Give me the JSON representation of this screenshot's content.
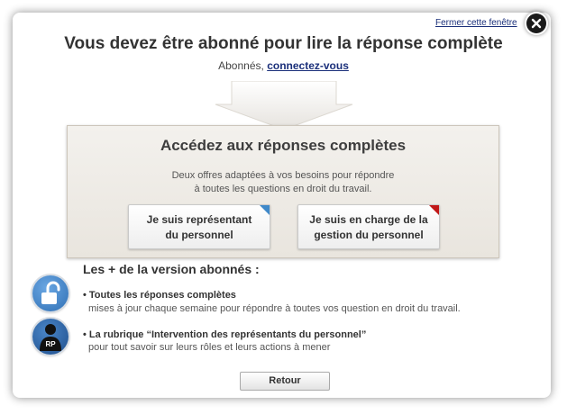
{
  "header": {
    "close_link": "Fermer cette fenêtre",
    "title": "Vous devez être abonné pour lire la réponse complète",
    "subscribers_prefix": "Abonnés,",
    "login_link": "connectez-vous"
  },
  "offer": {
    "title": "Accédez aux réponses complètes",
    "desc_line1": "Deux offres adaptées à vos besoins pour répondre",
    "desc_line2": "à toutes les questions en droit du travail.",
    "choices": [
      {
        "line1": "Je suis représentant",
        "line2": "du personnel",
        "accent": "#3f89c9"
      },
      {
        "line1": "Je suis en charge de la",
        "line2": "gestion du personnel",
        "accent": "#c11818"
      }
    ]
  },
  "benefits": {
    "title": "Les + de la version abonnés :",
    "items": [
      {
        "title": "• Toutes les réponses complètes",
        "desc": "mises à jour chaque semaine pour répondre à toutes vos question en droit du travail.",
        "icon": "unlock-icon"
      },
      {
        "title": "• La rubrique “Intervention des représentants du personnel”",
        "desc": "pour tout savoir sur leurs rôles et leurs actions à mener",
        "icon": "rp-person-icon",
        "icon_text": "RP"
      }
    ]
  },
  "footer": {
    "back_label": "Retour"
  }
}
